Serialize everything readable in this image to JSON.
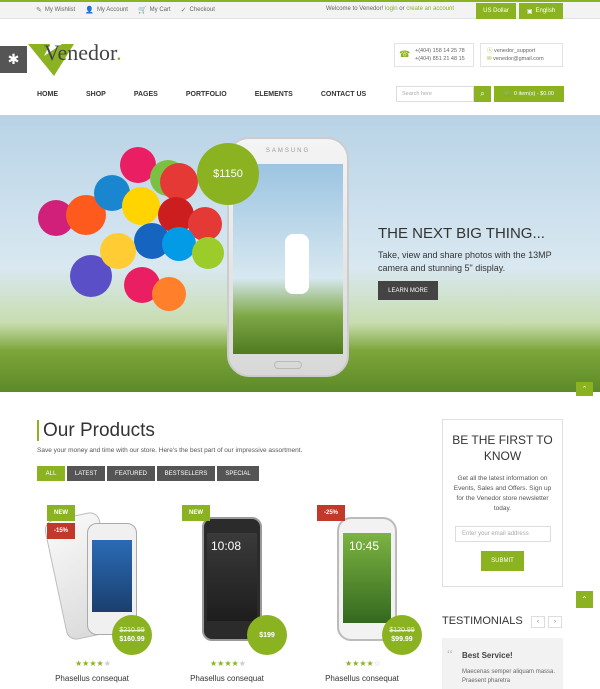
{
  "topbar": {
    "links": [
      "My Wishlist",
      "My Account",
      "My Cart",
      "Checkout"
    ],
    "welcome": "Welcome to Venedor!",
    "login": "login",
    "or": "or",
    "create": "create an account",
    "currency": "US Dollar",
    "language": "English"
  },
  "header": {
    "logo": "Venedor",
    "phone1": "+(404) 158 14 25 78",
    "phone2": "+(404) 851 21 48 15",
    "skype": "venedor_support",
    "email": "venedor@gmail.com",
    "nav": [
      "HOME",
      "SHOP",
      "PAGES",
      "PORTFOLIO",
      "ELEMENTS",
      "CONTACT US"
    ],
    "search_placeholder": "Search here",
    "cart": "0 item(s) - $0.00"
  },
  "hero": {
    "price": "$1150",
    "phone_brand": "SAMSUNG",
    "title": "THE NEXT BIG THING...",
    "text": "Take, view and share photos with the 13MP camera and stunning 5\" display.",
    "button": "LEARN MORE"
  },
  "products_section": {
    "title": "Our Products",
    "subtitle": "Save your money and time with our store. Here's the best part of our impressive assortment.",
    "tabs": [
      "ALL",
      "LATEST",
      "FEATURED",
      "BESTSELLERS",
      "SPECIAL"
    ],
    "items": [
      {
        "badges": [
          "NEW",
          "-15%"
        ],
        "old_price": "$210.99",
        "price": "$160.99",
        "rating": 4,
        "name": "Phasellus consequat",
        "screen_time": ""
      },
      {
        "badges": [
          "NEW"
        ],
        "old_price": "",
        "price": "$199",
        "rating": 4,
        "name": "Phasellus consequat",
        "screen_time": "10:08"
      },
      {
        "badges": [
          "-25%"
        ],
        "old_price": "$120.99",
        "price": "$99.99",
        "rating": 4.5,
        "name": "Phasellus consequat",
        "screen_time": "10:45"
      }
    ]
  },
  "newsletter": {
    "title": "BE THE FIRST TO KNOW",
    "text": "Get all the latest information on Events, Sales and Offers. Sign up for the Venedor store newsletter today.",
    "placeholder": "Enter your email address",
    "button": "SUBMIT"
  },
  "testimonials": {
    "title": "TESTIMONIALS",
    "quote_title": "Best Service!",
    "quote_text": "Maecenas semper aliquam massa. Praesent pharetra"
  },
  "colors": {
    "accent": "#8bb321",
    "dark": "#444444",
    "badge_red": "#c0392b"
  }
}
